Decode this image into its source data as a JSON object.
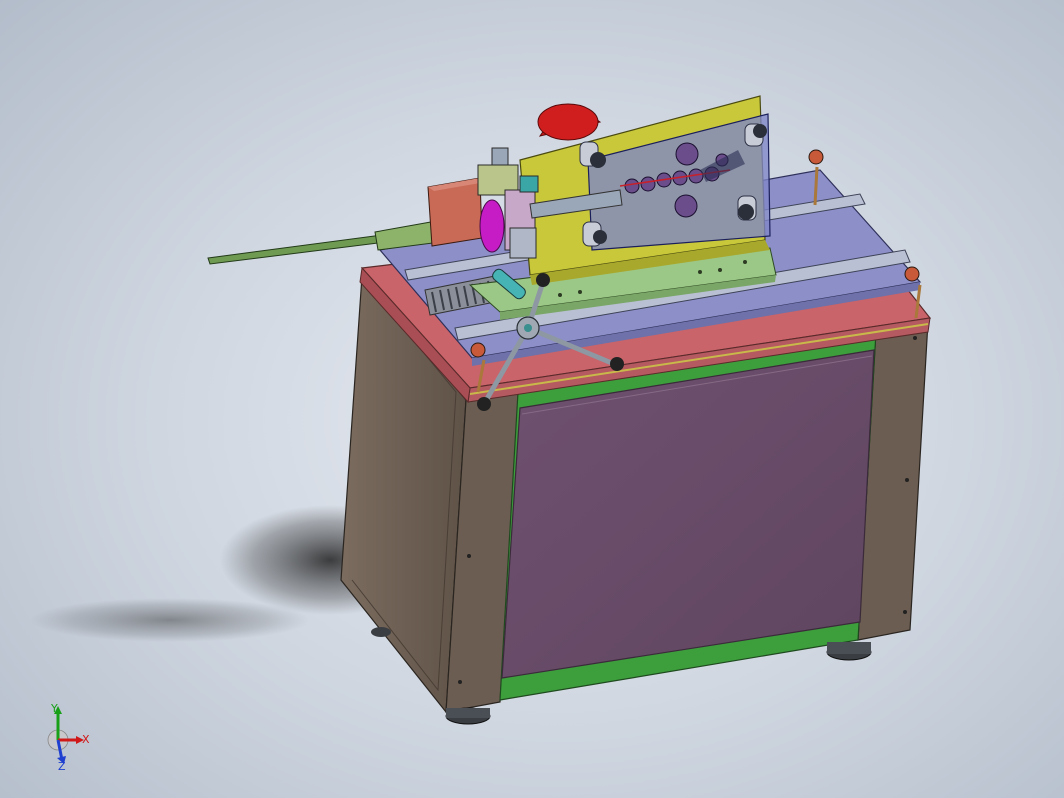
{
  "viewport": {
    "background_top": "#cfd6e0",
    "background_bottom": "#aab4c3"
  },
  "model": {
    "colors": {
      "cabinet_side": "#6e5f52",
      "cabinet_front_panel": "#6a4d68",
      "cabinet_frame_green": "#3d9e3c",
      "top_plate_red": "#c8646a",
      "rail_plate_blue": "#8c8fc8",
      "yellow_bracket": "#c8c83a",
      "red_dome": "#cc1b1b",
      "magenta_disk": "#c61cc6",
      "transparent_panel": "#7f86c8",
      "green_strip": "#6f9a52",
      "handwheel_gray": "#8e98a3"
    }
  },
  "triad": {
    "x_label": "X",
    "y_label": "Y",
    "z_label": "Z",
    "x_color": "#d01818",
    "y_color": "#19a019",
    "z_color": "#1f3fd0"
  }
}
